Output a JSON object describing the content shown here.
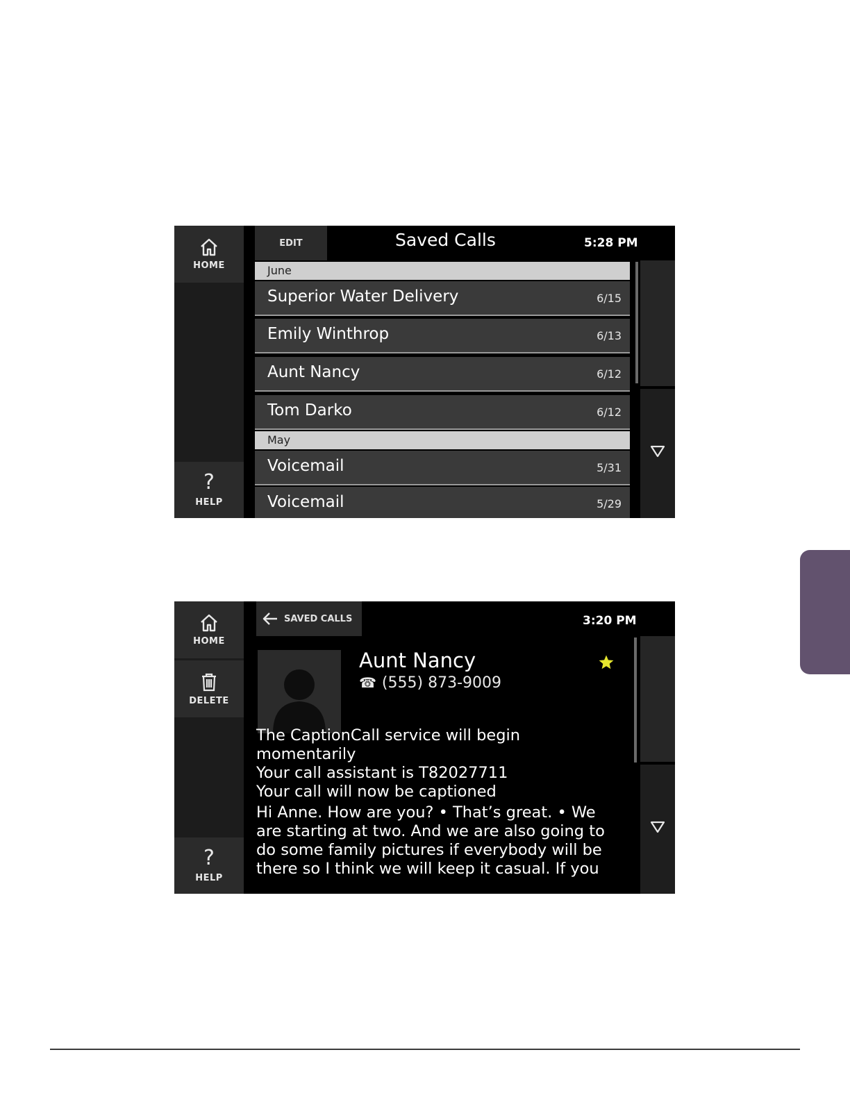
{
  "screen1": {
    "edit_label": "EDIT",
    "title": "Saved Calls",
    "time": "5:28 PM",
    "home_label": "HOME",
    "help_label": "HELP",
    "help_glyph": "?",
    "groups": [
      {
        "label": "June",
        "items": [
          {
            "name": "Superior Water Delivery",
            "date": "6/15"
          },
          {
            "name": "Emily Winthrop",
            "date": "6/13"
          },
          {
            "name": "Aunt Nancy",
            "date": "6/12"
          },
          {
            "name": "Tom Darko",
            "date": "6/12"
          }
        ]
      },
      {
        "label": "May",
        "items": [
          {
            "name": "Voicemail",
            "date": "5/31"
          },
          {
            "name": "Voicemail",
            "date": "5/29"
          }
        ]
      }
    ],
    "icons": [
      "home-icon",
      "question-icon",
      "scroll-down-icon"
    ]
  },
  "screen2": {
    "back_label": "SAVED CALLS",
    "time": "3:20 PM",
    "home_label": "HOME",
    "delete_label": "DELETE",
    "help_label": "HELP",
    "help_glyph": "?",
    "contact_name": "Aunt Nancy",
    "phone_glyph": "☎",
    "contact_phone": "(555) 873-9009",
    "star_color": "#e6e62e",
    "caption_lines": [
      "The CaptionCall service will begin",
      "momentarily",
      "Your call assistant is T82027711",
      "Your call will now be captioned",
      "Hi Anne. How are you? • That’s great. • We",
      "are starting at two. And we are also going to",
      "do some family pictures if everybody will be",
      "there so I think we will keep it casual. If you"
    ],
    "icons": [
      "home-icon",
      "trash-icon",
      "question-icon",
      "back-arrow-icon",
      "favorite-star-icon",
      "phone-icon",
      "scroll-down-icon"
    ]
  },
  "page": {
    "side_tab_color": "#62526e"
  }
}
